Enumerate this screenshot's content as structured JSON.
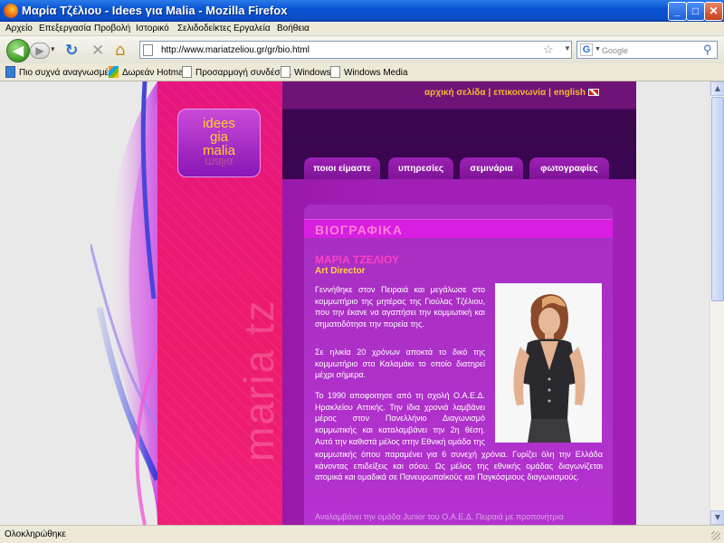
{
  "window": {
    "title": "Μαρία Τζέλιου - Idees για Malia - Mozilla Firefox",
    "min_glyph": "_",
    "max_glyph": "□",
    "close_glyph": "✕"
  },
  "menu": [
    "Αρχείο",
    "Επεξεργασία",
    "Προβολή",
    "Ιστορικό",
    "Σελιδοδείκτες",
    "Εργαλεία",
    "Βοήθεια"
  ],
  "nav": {
    "back_glyph": "◀",
    "forward_glyph": "▶",
    "history_glyph": "▾",
    "reload_glyph": "↻",
    "stop_glyph": "✕",
    "home_glyph": "⌂",
    "url": "http://www.mariatzeliou.gr/gr/bio.html",
    "star_glyph": "☆",
    "url_dropdown_glyph": "▼",
    "search_engine_glyph": "G",
    "search_dropdown_glyph": "▼",
    "search_placeholder": "Google",
    "search_glyph": "⚲"
  },
  "bookmarks": [
    "Πιο συχνά αναγνωσμέ...",
    "Δωρεάν Hotmail",
    "Προσαρμογή συνδέσε...",
    "Windows",
    "Windows Media"
  ],
  "scrollbar": {
    "up_glyph": "▲",
    "down_glyph": "▼"
  },
  "status": "Ολοκληρώθηκε",
  "site": {
    "logo": {
      "line1": "idees",
      "line2": "gia",
      "line3": "malia",
      "reflection": "malia"
    },
    "vertical_text": "maria tz",
    "top_links": [
      "αρχική σελίδα",
      "επικοινωνία",
      "english"
    ],
    "tabs": [
      "ποιοι είμαστε",
      "υπηρεσίες",
      "σεμινάρια",
      "φωτογραφίες"
    ],
    "section_title": "ΒΙΟΓΡΑΦΙΚΑ",
    "name": "ΜΑΡΙΑ ΤΖΕΛΙΟΥ",
    "role": "Art Director",
    "bio": [
      "Γεννήθηκε στον Πειραιά και μεγάλωσε στο κομμωτήριο της μητέρας της Γιούλας Τζέλιου, που την έκανε να αγαπήσει την κομμωτική και σηματοδότησε την πορεία της.",
      "Σε ηλικία 20 χρόνων αποκτά το δικό της κομμωτήριο στο Καλαμάκι το οποίο διατηρεί μέχρι σήμερα.",
      "Το 1990 αποφοιτησε από τη σχολή Ο.Α.Ε.Δ. Ηρακλείου Αττικής. Την ίδια χρονιά λαμβάνει μέρος στον Πανελλήνιο Διαγωνισμό κομμωτικής και καταλαμβάνει την 2η θέση. Αυτό την καθιστά μέλος στην Εθνική ομάδα της",
      "κομμωτικής όπου παραμένει για 6 συνεχή χρόνια. Γυρίζει όλη την Ελλάδα κάνοντας επιδείξεις και σόου. Ως μέλος της εθνικής ομάδας διαγωνίζεται ατομικά και ομαδικά σε Πανευρωπαϊκούς και Παγκόσμιους διαγωνισμούς.",
      "Αναλαμβάνει την ομάδα Junior του Ο.Α.Ε.Δ. Πειραιά με προπονήτρια"
    ]
  }
}
